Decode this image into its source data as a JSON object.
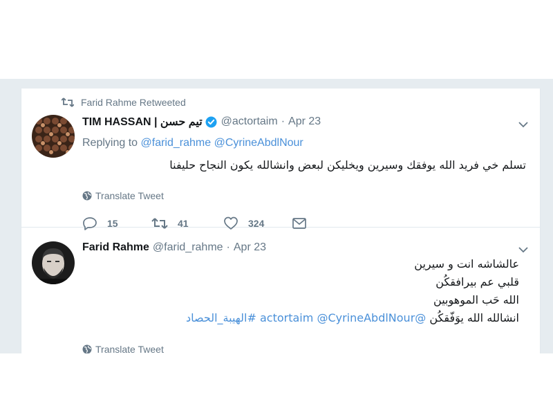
{
  "tweet1": {
    "retweet_context": "Farid Rahme Retweeted",
    "fullname": "TIM HASSAN | تيم حسن",
    "username": "@actortaim",
    "separator": "·",
    "date": "Apr 23",
    "replying_to_label": "Replying to",
    "replying_to_mentions": [
      "@farid_rahme",
      "@CyrineAbdlNour"
    ],
    "text": "تسلم خي فريد الله يوفقك وسيرين ويخليكن لبعض وانشالله يكون النجاح حليفنا",
    "translate_label": "Translate Tweet",
    "reply_count": "15",
    "retweet_count": "41",
    "like_count": "324"
  },
  "tweet2": {
    "fullname": "Farid Rahme",
    "username": "@farid_rahme",
    "separator": "·",
    "date": "Apr 23",
    "lines": [
      "عالشاشه انت و سيرين",
      "قلبي عم بيرافقكُن",
      "الله حَب الموهوبين"
    ],
    "last_line_text": "انشالله الله يوَفّقكُن",
    "last_line_mentions": [
      "@actortaim",
      "@CyrineAbdlNour"
    ],
    "last_line_hashtag": "#الهيبة_الحصاد",
    "translate_label": "Translate Tweet"
  },
  "colors": {
    "link": "#4a90d9",
    "muted": "#657786",
    "verified": "#1da1f2",
    "background": "#e6ecf0"
  },
  "icons": [
    "retweet-icon",
    "verified-badge-icon",
    "caret-down-icon",
    "globe-icon",
    "reply-icon",
    "like-icon",
    "direct-message-icon"
  ]
}
